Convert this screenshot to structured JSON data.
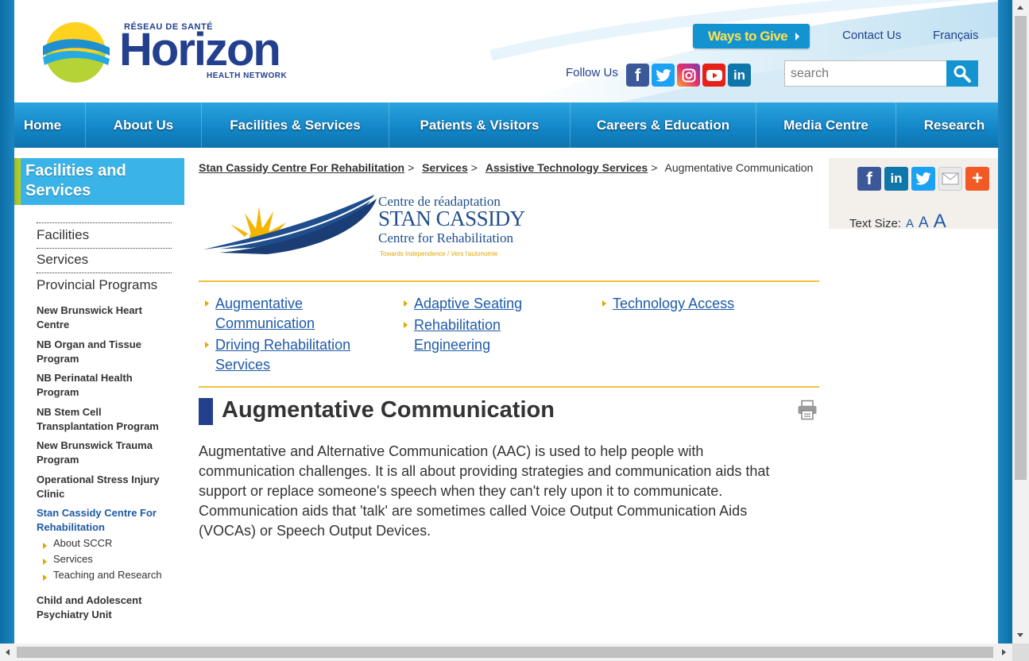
{
  "header": {
    "logo": {
      "top": "RÉSEAU DE SANTÉ",
      "word": "Horizon",
      "bottom": "HEALTH NETWORK"
    },
    "ways_to_give": "Ways to Give",
    "contact_us": "Contact Us",
    "francais": "Français",
    "follow_us": "Follow Us",
    "social": [
      "facebook-icon",
      "twitter-icon",
      "instagram-icon",
      "youtube-icon",
      "linkedin-icon"
    ],
    "search_placeholder": "search"
  },
  "nav": [
    "Home",
    "About Us",
    "Facilities & Services",
    "Patients & Visitors",
    "Careers & Education",
    "Media Centre",
    "Research"
  ],
  "sidebar": {
    "title": "Facilities and Services",
    "level1": [
      "Facilities",
      "Services",
      "Provincial Programs"
    ],
    "programs": [
      "New Brunswick Heart Centre",
      "NB Organ and Tissue Program",
      "NB Perinatal Health Program",
      "NB Stem Cell Transplantation Program",
      "New Brunswick Trauma Program",
      "Operational Stress Injury Clinic",
      "Stan Cassidy Centre For Rehabilitation",
      "Child and Adolescent Psychiatry Unit"
    ],
    "sub": [
      "About SCCR",
      "Services",
      "Teaching and Research"
    ]
  },
  "breadcrumb": [
    "Stan Cassidy Centre For Rehabilitation",
    "Services",
    "Assistive Technology Services",
    "Augmentative Communication"
  ],
  "sccr_logo": {
    "fr": "Centre de réadaptation",
    "name": "STAN CASSIDY",
    "en": "Centre for Rehabilitation",
    "tagline": "Towards Independence / Vers l'autonomie"
  },
  "sub_links": {
    "col1": [
      "Augmentative Communication",
      "Driving Rehabilitation Services"
    ],
    "col2": [
      "Adaptive Seating",
      "Rehabilitation Engineering"
    ],
    "col3": [
      "Technology Access"
    ]
  },
  "page_title": "Augmentative Communication",
  "body": "Augmentative and Alternative Communication (AAC) is used to help people with communication challenges. It is all about providing strategies and communication aids that support or replace someone's speech when they can't rely upon it to communicate. Communication aids that 'talk' are sometimes called Voice Output Communication Aids (VOCAs) or Speech Output Devices.",
  "right_panel": {
    "share": [
      "facebook-icon",
      "linkedin-icon",
      "twitter-icon",
      "email-icon",
      "add-icon"
    ],
    "text_size_label": "Text Size:",
    "sizes": [
      "A",
      "A",
      "A"
    ]
  },
  "colors": {
    "brand_blue": "#23408e",
    "nav_blue": "#1493d1",
    "accent_gold": "#f0c040",
    "link_blue": "#1e5aa8"
  }
}
